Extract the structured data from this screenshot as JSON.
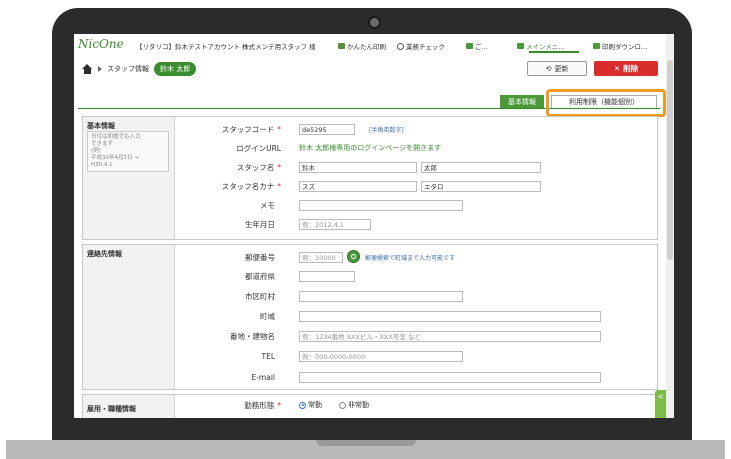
{
  "topbar": {
    "logo": "NicOne",
    "account": "【リタリコ】鈴木テストアカウント 株式メンテ用スタッフ 様",
    "nav": [
      {
        "label": "かんたん印刷",
        "icon": "printer-icon"
      },
      {
        "label": "業務チェック",
        "icon": "info-icon"
      },
      {
        "label": "ご…",
        "icon": "bars-icon"
      },
      {
        "label": "メインメニ…",
        "icon": "bars-icon"
      },
      {
        "label": "印刷ダウンロ…",
        "icon": "bars-icon"
      }
    ]
  },
  "breadcrumb": {
    "item1": "スタッフ情報",
    "current": "鈴木 太郎"
  },
  "actions": {
    "update": "更新",
    "delete": "削除"
  },
  "tabs": {
    "basic": "基本情報",
    "usage": "利用制限（機能個別）"
  },
  "sections": {
    "basic": {
      "title": "基本情報",
      "note": "日付は和暦でも入力\nできます\n(例)\n平成30年4月1日 →\nH30.4.1",
      "fields": {
        "staff_code_label": "スタッフコード",
        "staff_code_value": "de5295",
        "staff_code_hint": "[半角英数字]",
        "login_url_label": "ログインURL",
        "login_url_text": "鈴木 太郎様専用のログインページを開きます",
        "name_label": "スタッフ名",
        "last_name": "鈴木",
        "first_name": "太郎",
        "kana_label": "スタッフ名カナ",
        "last_kana": "スズ",
        "first_kana": "エタロ",
        "memo_label": "メモ",
        "memo_value": "",
        "birth_label": "生年月日",
        "birth_placeholder": "例：2012.4.1"
      }
    },
    "contact": {
      "title": "連絡先情報",
      "fields": {
        "zip_label": "郵便番号",
        "zip_placeholder": "例：10000",
        "zip_hint": "郵便検索で町域まで入力可能です",
        "pref_label": "都道府県",
        "city_label": "市区町村",
        "town_label": "町域",
        "address_label": "番地・建物名",
        "address_placeholder": "例：1234番地 XXXビル・XXX号室 など",
        "tel_label": "TEL",
        "tel_placeholder": "例：000-0000-0000",
        "email_label": "E-mail"
      }
    },
    "employment": {
      "title": "雇用・職種情報",
      "fields": {
        "work_label": "勤務形態",
        "option_full": "常勤",
        "option_part": "非常勤"
      }
    }
  },
  "required_mark": "*",
  "side_tab": "<",
  "colors": {
    "accent": "#3a8b2e",
    "delete": "#d92d2d",
    "highlight": "#f39a1e"
  }
}
